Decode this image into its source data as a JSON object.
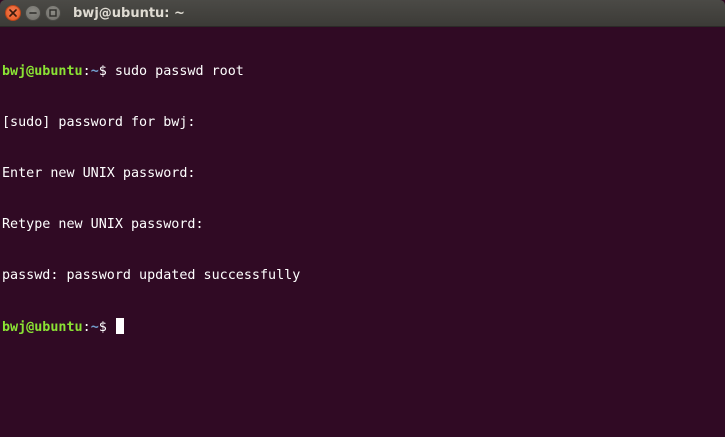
{
  "window": {
    "title": "bwj@ubuntu: ~"
  },
  "colors": {
    "background": "#300a24",
    "prompt_user": "#8ae234",
    "prompt_path": "#729fcf",
    "text": "#ffffff",
    "close_button": "#e2561d"
  },
  "icons": {
    "close": "close-icon",
    "minimize": "minimize-icon",
    "maximize": "maximize-icon"
  },
  "terminal": {
    "prompt_user_host": "bwj@ubuntu",
    "prompt_path": "~",
    "prompt_symbol": "$ ",
    "command": "sudo passwd root",
    "output": [
      "[sudo] password for bwj:",
      "Enter new UNIX password:",
      "Retype new UNIX password:",
      "passwd: password updated successfully"
    ]
  }
}
